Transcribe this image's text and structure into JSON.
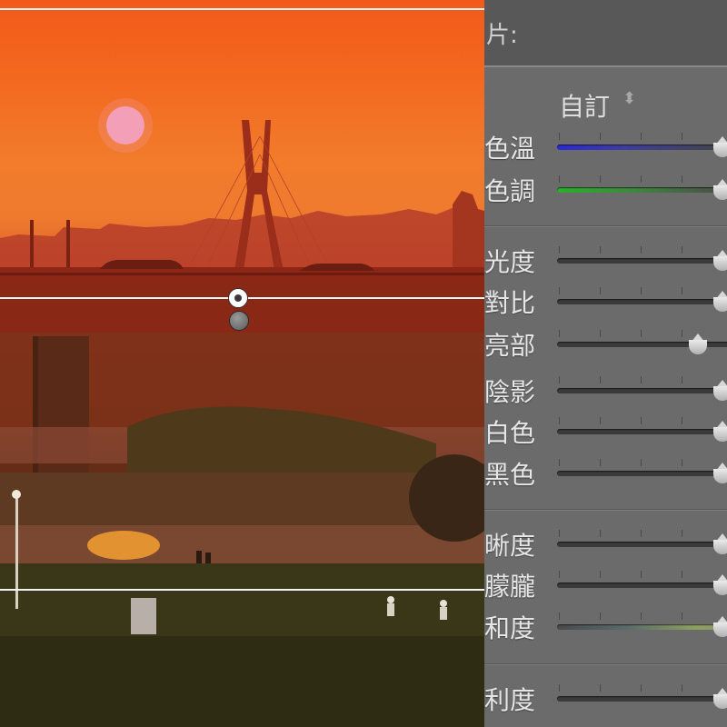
{
  "panel": {
    "title": "片:",
    "preset_value": "自訂",
    "preset_arrow": "⬍"
  },
  "sliders": [
    {
      "label": "色溫",
      "style": "temp",
      "value_pct": 100
    },
    {
      "label": "色調",
      "style": "tint",
      "value_pct": 100
    },
    {
      "label": "光度",
      "style": "plain",
      "value_pct": 100
    },
    {
      "label": "對比",
      "style": "plain",
      "value_pct": 100
    },
    {
      "label": "亮部",
      "style": "plain",
      "value_pct": 85
    },
    {
      "label": "陰影",
      "style": "plain",
      "value_pct": 100
    },
    {
      "label": "白色",
      "style": "plain",
      "value_pct": 100
    },
    {
      "label": "黑色",
      "style": "plain",
      "value_pct": 100
    },
    {
      "label": "晰度",
      "style": "plain",
      "value_pct": 100
    },
    {
      "label": "朦朧",
      "style": "plain",
      "value_pct": 100
    },
    {
      "label": "和度",
      "style": "sat",
      "value_pct": 100
    },
    {
      "label": "利度",
      "style": "plain",
      "value_pct": 100
    }
  ],
  "colors": {
    "panel_bg": "#6b6b6b",
    "sky_orange": "#f25a1a",
    "sun_pink": "#f08fb0"
  },
  "icons": {
    "filter_pin": "graduated-filter-pin-icon",
    "slider_thumb": "slider-thumb-icon"
  }
}
